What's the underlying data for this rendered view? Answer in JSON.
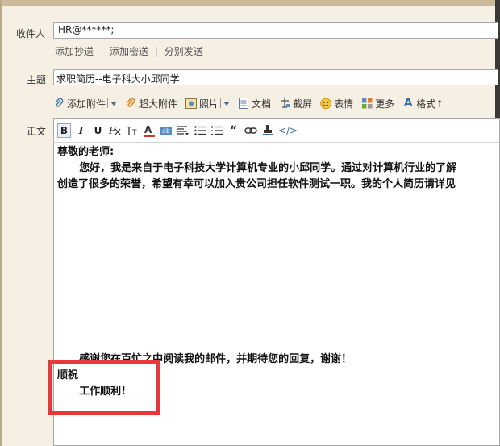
{
  "compose": {
    "to_label": "收件人",
    "to_value": "HR@******;",
    "add_cc": "添加抄送",
    "add_sep1": "-",
    "add_bcc": "添加密送",
    "add_sep2": "|",
    "send_separately": "分别发送",
    "subject_label": "主题",
    "subject_value": "求职简历--电子科大小邱同学",
    "body_label": "正文"
  },
  "attach_toolbar": {
    "add_attachment": "添加附件",
    "large_attachment": "超大附件",
    "photo": "照片",
    "document": "文档",
    "screenshot": "截屏",
    "emoji": "表情",
    "more": "更多",
    "format": "格式↑"
  },
  "format_toolbar": {
    "bold": "B",
    "italic": "I",
    "underline": "U",
    "html": "</>"
  },
  "body": {
    "greeting": "尊敬的老师:",
    "line1": "      您好，我是来自于电子科技大学计算机专业的小邱同学。通过对计算机行业的了解",
    "line2": "创造了很多的荣誉，希望有幸可以加入贵公司担任软件测试一职。我的个人简历请详见",
    "thanks": "      感谢您在百忙之中阅读我的邮件，并期待您的回复，谢谢！",
    "closing": "顺祝",
    "wish": "      工作顺利!"
  },
  "colors": {
    "background": "#f6f0e4",
    "highlight": "#e8383d"
  }
}
